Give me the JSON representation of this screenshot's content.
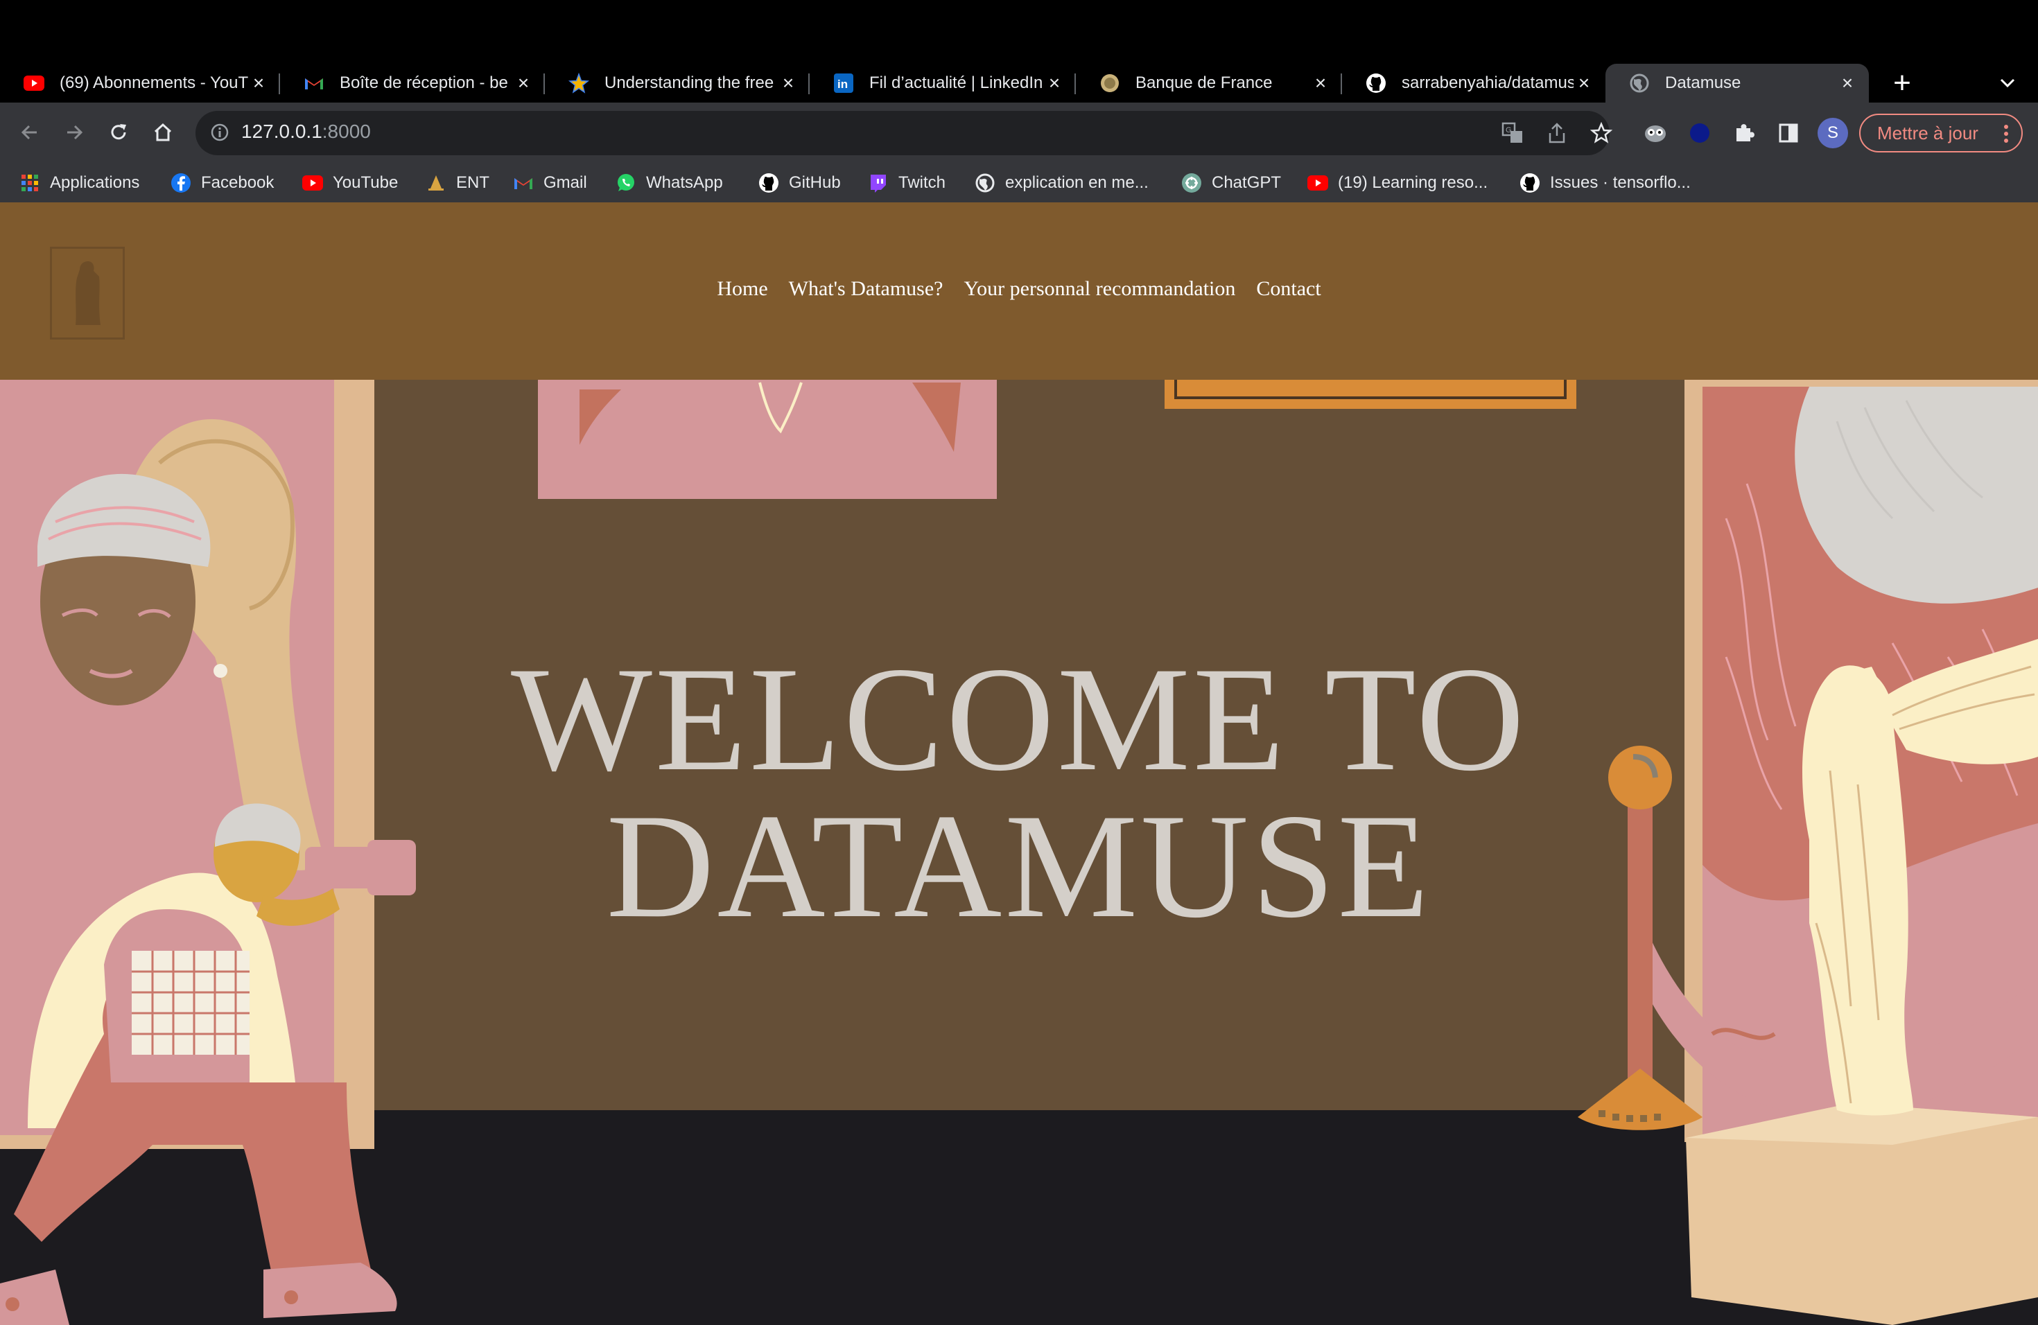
{
  "browser": {
    "tabs": [
      {
        "title": "(69) Abonnements - YouTube",
        "icon": "youtube-icon"
      },
      {
        "title": "Boîte de réception - be",
        "icon": "gmail-icon"
      },
      {
        "title": "Understanding the free",
        "icon": "star-icon"
      },
      {
        "title": "Fil d’actualité | LinkedIn",
        "icon": "linkedin-icon"
      },
      {
        "title": "Banque de France",
        "icon": "banque-de-france-icon"
      },
      {
        "title": "sarrabenyahia/datamuse",
        "icon": "github-icon"
      },
      {
        "title": "Datamuse",
        "icon": "globe-icon",
        "active": true
      }
    ],
    "address": {
      "host": "127.0.0.1",
      "port": ":8000"
    },
    "update_button": "Mettre à jour",
    "profile_initial": "S",
    "bookmarks": [
      {
        "label": "Applications",
        "icon": "apps-grid-icon"
      },
      {
        "label": "Facebook",
        "icon": "facebook-icon"
      },
      {
        "label": "YouTube",
        "icon": "youtube-icon"
      },
      {
        "label": "ENT",
        "icon": "ent-icon"
      },
      {
        "label": "Gmail",
        "icon": "gmail-icon"
      },
      {
        "label": "WhatsApp",
        "icon": "whatsapp-icon"
      },
      {
        "label": "GitHub",
        "icon": "github-icon"
      },
      {
        "label": "Twitch",
        "icon": "twitch-icon"
      },
      {
        "label": "explication en me...",
        "icon": "globe-icon"
      },
      {
        "label": "ChatGPT",
        "icon": "chatgpt-icon"
      },
      {
        "label": "(19) Learning reso...",
        "icon": "youtube-icon"
      },
      {
        "label": "Issues · tensorflo...",
        "icon": "github-icon"
      }
    ],
    "colors": {
      "tabstrip": "#000000",
      "toolbar": "#35363a",
      "accent_update": "#f28b82"
    }
  },
  "site": {
    "nav": [
      "Home",
      "What's Datamuse?",
      "Your personnal recommandation",
      "Contact"
    ],
    "hero": {
      "line1": "WELCOME TO",
      "line2": "DATAMUSE"
    },
    "colors": {
      "header": "#7f5a2d",
      "wall": "#654f37",
      "floor": "#1c1b1f",
      "title": "#d4cfc9",
      "pink": "#d4979a"
    }
  }
}
